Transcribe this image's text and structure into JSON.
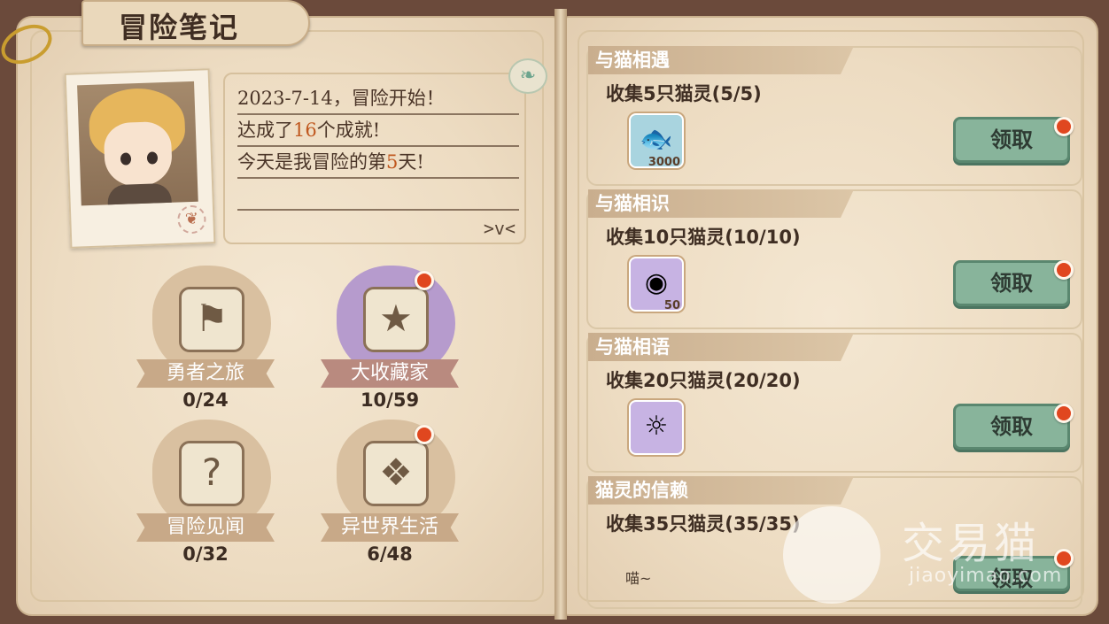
{
  "header": {
    "title": "冒险笔记"
  },
  "notes": {
    "line1": "2023-7-14，冒险开始！",
    "line2_prefix": "达成了",
    "line2_value": "16",
    "line2_suffix": "个成就!",
    "line3_prefix": "今天是我冒险的第",
    "line3_value": "5",
    "line3_suffix": "天!",
    "sign": ">v<"
  },
  "categories": [
    {
      "label": "勇者之旅",
      "count": "0/24",
      "icon": "flag-icon",
      "has_dot": false
    },
    {
      "label": "大收藏家",
      "count": "10/59",
      "icon": "treasure-box-icon",
      "has_dot": true
    },
    {
      "label": "冒险见闻",
      "count": "0/32",
      "icon": "question-map-icon",
      "has_dot": false
    },
    {
      "label": "异世界生活",
      "count": "6/48",
      "icon": "card-icon",
      "has_dot": true
    }
  ],
  "achievements": [
    {
      "tag": "与猫相遇",
      "desc": "收集5只猫灵(5/5)",
      "reward_qty": "3000",
      "reward_icon": "taiyaki-icon",
      "button": "领取"
    },
    {
      "tag": "与猫相识",
      "desc": "收集10只猫灵(10/10)",
      "reward_qty": "50",
      "reward_icon": "fish-jelly-icon",
      "button": "领取"
    },
    {
      "tag": "与猫相语",
      "desc": "收集20只猫灵(20/20)",
      "reward_qty": "",
      "reward_icon": "cat-badge-icon",
      "button": "领取"
    },
    {
      "tag": "猫灵的信赖",
      "desc": "收集35只猫灵(35/35)",
      "reward_qty": "",
      "reward_icon": "",
      "button": "领取"
    }
  ],
  "footer": {
    "meow": "喵~"
  },
  "watermark": {
    "text": "交易猫",
    "url": "jiaoyimao.com"
  },
  "colors": {
    "accent_red": "#e0471f",
    "button_green": "#88b49b",
    "highlight": "#c0581f"
  }
}
